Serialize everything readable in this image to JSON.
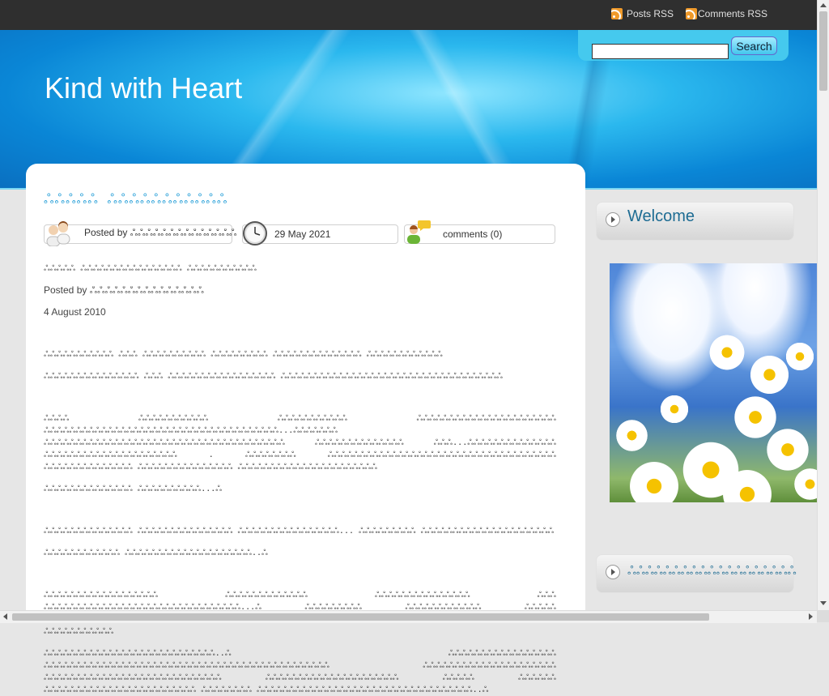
{
  "topbar": {
    "posts_rss": "Posts RSS",
    "comments_rss": "Comments RSS"
  },
  "header": {
    "site_title": "Kind with Heart",
    "search_button": "Search",
    "search_value": ""
  },
  "post": {
    "title": "ஃஃஃஃஃ ஃஃஃஃஃஃஃஃஃஃஃ",
    "meta": {
      "posted_by": "Posted by ஃஃஃஃஃஃஃஃஃஃஃஃஃஃ",
      "date": "29 May 2021",
      "comments": "comments (0)"
    },
    "body": {
      "line1": "ஃஃஃஃஃ ஃஃஃஃஃஃஃஃஃஃஃஃஃஃஃஃ ஃஃஃஃஃஃஃஃஃஃஃ",
      "line2": "Posted by ஃஃஃஃஃஃஃஃஃஃஃஃஃஃஃ",
      "line3": "4 August 2010",
      "p1": "ஃஃஃஃஃஃஃஃஃஃஃ ஃஃஃ ஃஃஃஃஃஃஃஃஃஃ ஃஃஃஃஃஃஃஃஃ ஃஃஃஃஃஃஃஃஃஃஃஃஃஃ ஃஃஃஃஃஃஃஃஃஃஃஃ",
      "p2": "ஃஃஃஃஃஃஃஃஃஃஃஃஃஃஃ ஃஃஃ ஃஃஃஃஃஃஃஃஃஃஃஃஃஃஃஃஃ ஃஃஃஃஃஃஃஃஃஃஃஃஃஃஃஃஃஃஃஃஃஃஃஃஃஃஃஃஃஃஃஃஃஃஃ",
      "p3": "ஃஃஃஃ ஃஃஃஃஃஃஃஃஃஃஃ ஃஃஃஃஃஃஃஃஃஃஃ ஃஃஃஃஃஃஃஃஃஃஃஃஃஃஃஃஃஃஃஃஃஃ ஃஃஃஃஃஃஃஃஃஃஃஃஃஃஃஃஃஃஃஃஃஃஃஃஃஃஃஃஃஃஃஃஃஃஃஃஃ...ஃஃஃஃஃஃஃ ஃஃஃஃஃஃஃஃஃஃஃஃஃஃஃஃஃஃஃஃஃஃஃஃஃஃஃஃஃஃஃஃஃஃஃஃஃஃ ஃஃஃஃஃஃஃஃஃஃஃஃஃஃ ஃஃஃ...ஃஃஃஃஃஃஃஃஃஃஃஃஃஃ ஃஃஃஃஃஃஃஃஃஃஃஃஃஃஃஃஃஃஃஃஃ . ஃஃஃஃஃஃஃஃ ஃஃஃஃஃஃஃஃஃஃஃஃஃஃஃஃஃஃஃஃஃஃஃஃஃஃஃஃஃஃஃஃஃஃஃஃ ஃஃஃஃஃஃஃஃஃஃஃஃஃஃ ஃஃஃஃஃஃஃஃஃஃஃஃஃஃஃ ஃஃஃஃஃஃஃஃஃஃஃஃஃஃஃஃஃஃஃஃஃஃ",
      "p4": "ஃஃஃஃஃஃஃஃஃஃஃஃஃஃ ஃஃஃஃஃஃஃஃஃஃ...ஃ",
      "p5": "ஃஃஃஃஃஃஃஃஃஃஃஃஃஃ ஃஃஃஃஃஃஃஃஃஃஃஃஃஃஃ ஃஃஃஃஃஃஃஃஃஃஃஃஃஃஃஃ... ஃஃஃஃஃஃஃஃஃ ஃஃஃஃஃஃஃஃஃஃஃஃஃஃஃஃஃஃஃஃஃ",
      "p6": "ஃஃஃஃஃஃஃஃஃஃஃஃ ஃஃஃஃஃஃஃஃஃஃஃஃஃஃஃஃஃஃஃஃ..ஃ",
      "p7": "ஃஃஃஃஃஃஃஃஃஃஃஃஃஃஃஃஃஃ ஃஃஃஃஃஃஃஃஃஃஃஃஃ ஃஃஃஃஃஃஃஃஃஃஃஃஃஃஃ ஃஃஃ ஃஃஃஃஃஃஃஃஃஃஃஃஃஃஃஃஃஃஃஃஃஃஃஃஃஃஃஃஃஃஃ...ஃ ஃஃஃஃஃஃஃஃஃ ஃஃஃஃஃஃஃஃஃஃஃஃ ஃஃஃஃஃ ஃஃஃஃஃஃஃஃஃஃஃஃஃஃஃஃஃஃஃஃஃஃஃஃஃஃஃஃஃஃஃஃஃ ஃஃஃஃஃஃஃஃஃ ஃஃஃஃஃஃஃஃஃஃஃஃஃஃஃஃஃஃ ஃஃஃஃஃஃஃஃஃ ஃஃஃஃஃஃஃஃஃஃஃ",
      "p8": "ஃஃஃஃஃஃஃஃஃஃஃஃஃஃஃஃஃஃஃஃஃஃஃஃஃஃஃ..ஃ ஃஃஃஃஃஃஃஃஃஃஃஃஃஃஃஃஃ ஃஃஃஃஃஃஃஃஃஃஃஃஃஃஃஃஃஃஃஃஃஃஃஃஃஃஃஃஃஃஃஃஃஃஃஃஃஃஃஃஃஃஃஃஃ ஃஃஃஃஃஃஃஃஃஃஃஃஃஃஃஃஃஃஃஃஃ ஃஃஃஃஃஃஃஃஃஃஃஃஃஃஃஃஃஃஃஃஃஃஃஃஃஃஃஃ ஃஃஃஃஃஃஃஃஃஃஃஃஃஃஃஃஃஃஃஃஃ ஃஃஃஃஃ ஃஃஃஃஃஃ ஃஃஃஃஃஃஃஃஃஃஃஃஃஃஃஃஃஃஃஃஃஃஃஃ ஃஃஃஃஃஃஃஃ ஃஃஃஃஃஃஃஃஃஃஃஃஃஃஃஃஃஃஃஃஃஃஃஃஃஃஃஃஃஃஃஃஃஃ..ஃ"
    }
  },
  "sidebar": {
    "welcome_title": "Welcome",
    "second_title": "ஃஃஃஃஃஃஃஃஃஃஃஃஃஃஃஃஃஃஃ"
  }
}
